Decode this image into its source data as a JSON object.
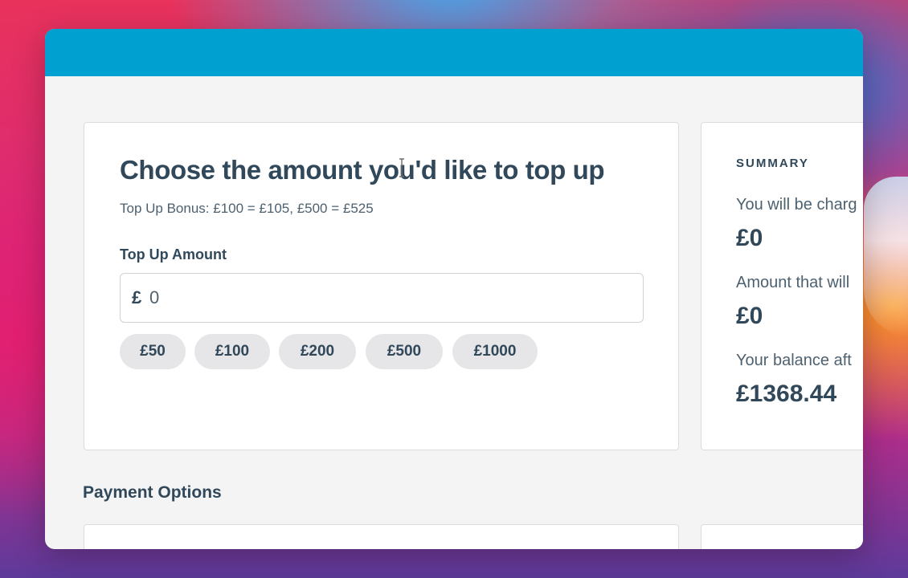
{
  "topup": {
    "title": "Choose the amount you'd like to top up",
    "bonus_text": "Top Up Bonus: £100 = £105, £500 = £525",
    "amount_label": "Top Up Amount",
    "currency_symbol": "£",
    "amount_value": "0",
    "presets": [
      "£50",
      "£100",
      "£200",
      "£500",
      "£1000"
    ]
  },
  "summary": {
    "heading": "SUMMARY",
    "rows": [
      {
        "label": "You will be charg",
        "value": "£0"
      },
      {
        "label": "Amount that will",
        "value": "£0"
      },
      {
        "label": "Your balance aft",
        "value": "£1368.44"
      }
    ]
  },
  "payment": {
    "title": "Payment Options"
  },
  "colors": {
    "topbar": "#00a0d1",
    "text_primary": "#30485a",
    "text_secondary": "#4d6170",
    "preset_bg": "#e6e6e8"
  }
}
